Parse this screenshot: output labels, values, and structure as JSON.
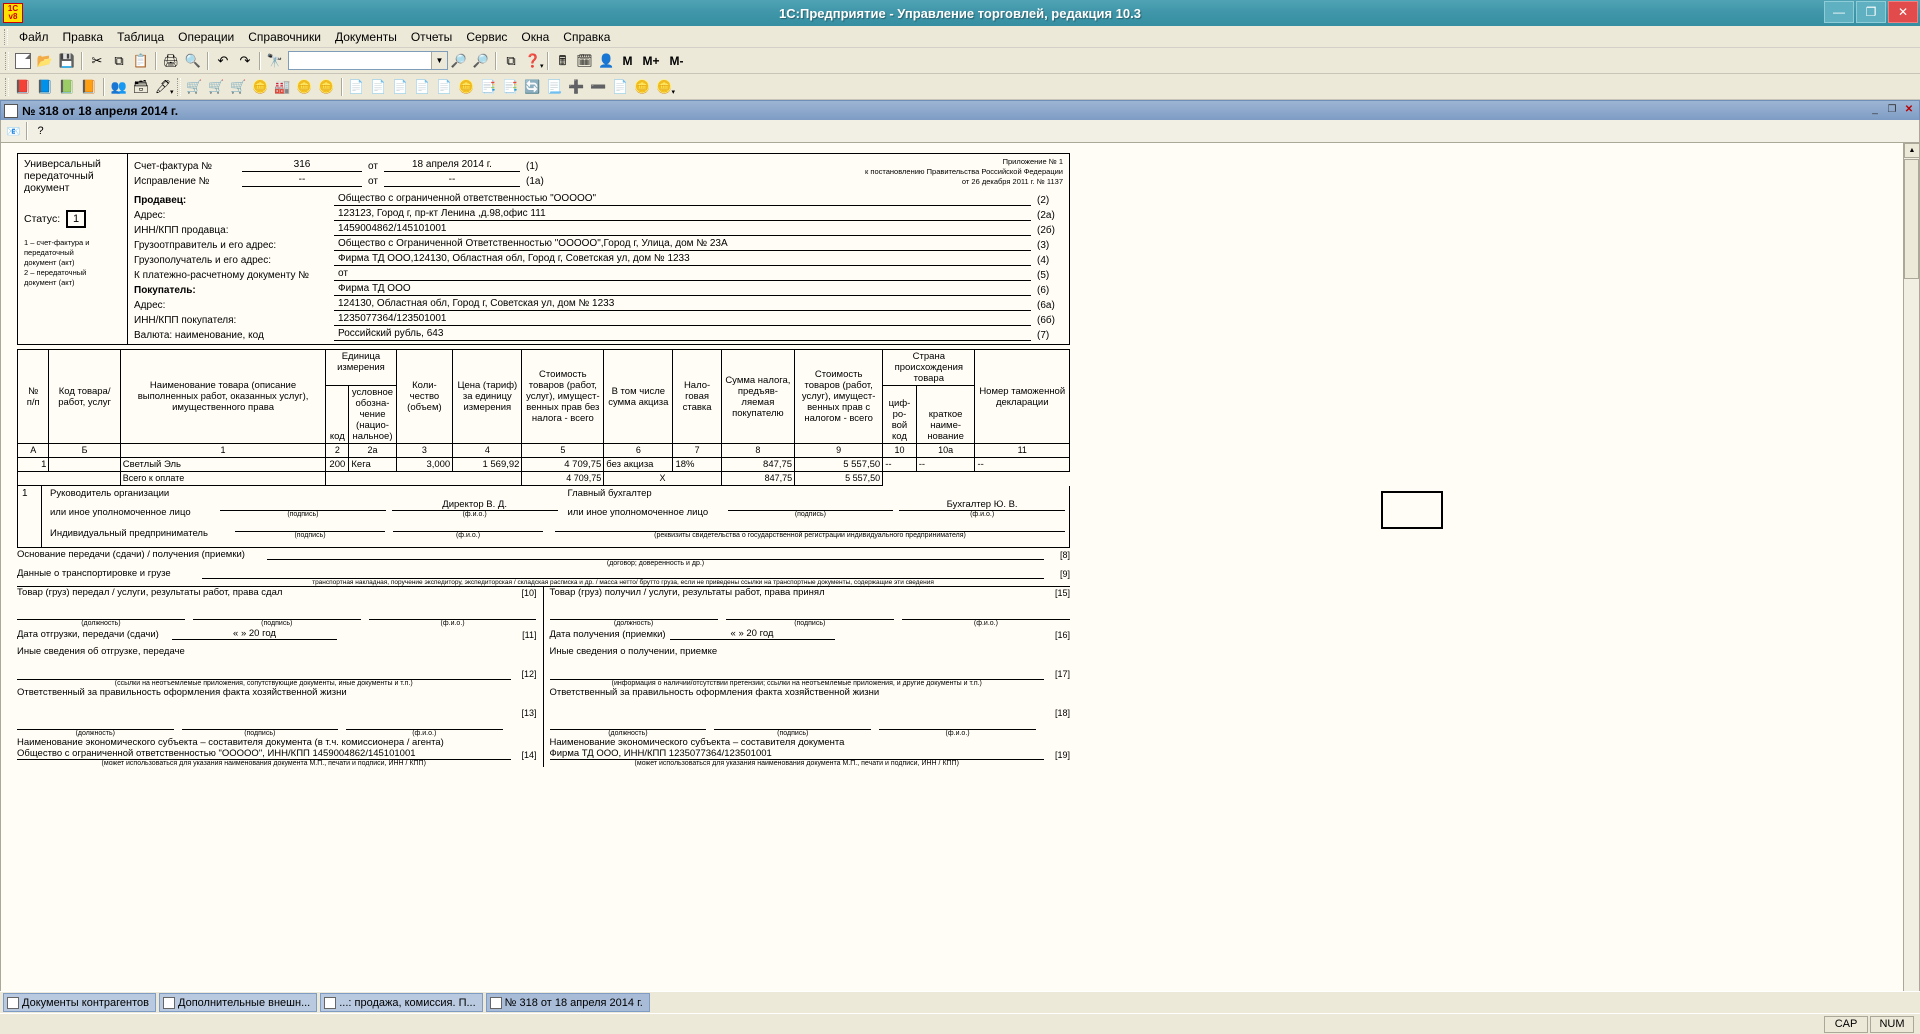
{
  "window": {
    "title": "1С:Предприятие - Управление торговлей, редакция 10.3",
    "logo_top": "1С",
    "logo_bottom": "v8",
    "minimize": "—",
    "maximize": "❐",
    "close": "✕"
  },
  "menu": [
    "Файл",
    "Правка",
    "Таблица",
    "Операции",
    "Справочники",
    "Документы",
    "Отчеты",
    "Сервис",
    "Окна",
    "Справка"
  ],
  "toolbar1": {
    "combo_value": "",
    "memory": [
      "М",
      "М+",
      "М-"
    ]
  },
  "child_window": {
    "title": "№ 318 от 18 апреля 2014 г.",
    "minimize": "_",
    "restore": "❐",
    "close": "✕",
    "help_button": "?"
  },
  "form": {
    "doc_type_lines": [
      "Универсальный",
      "передаточный",
      "документ"
    ],
    "status_label": "Статус:",
    "status_value": "1",
    "status_notes": [
      "1 – счет-фактура и",
      "передаточный",
      "документ (акт)",
      "2 – передаточный",
      "документ (акт)"
    ],
    "approval": [
      "Приложение № 1",
      "к постановлению Правительства Российской Федерации",
      "от 26 декабря 2011 г. № 1137"
    ],
    "rows": [
      {
        "label": "Счет-фактура №",
        "value": "316",
        "ot": "от",
        "value2": "18 апреля 2014 г.",
        "code": "(1)"
      },
      {
        "label": "Исправление №",
        "value": "--",
        "ot": "от",
        "value2": "--",
        "code": "(1a)"
      }
    ],
    "fields": [
      {
        "label": "Продавец:",
        "value": "Общество с ограниченной ответственностью \"ООООО\"",
        "code": "(2)",
        "bold": true
      },
      {
        "label": "Адрес:",
        "value": "123123, Город г, пр-кт Ленина ,д.98,офис 111",
        "code": "(2а)",
        "bold": false
      },
      {
        "label": "ИНН/КПП продавца:",
        "value": "1459004862/145101001",
        "code": "(2б)",
        "bold": false
      },
      {
        "label": "Грузоотправитель и его адрес:",
        "value": "Общество с Ограниченной Ответственностью \"ООООО\",Город г, Улица, дом № 23А",
        "code": "(3)",
        "bold": false
      },
      {
        "label": "Грузополучатель и его адрес:",
        "value": "Фирма ТД ООО,124130, Областная обл, Город г, Советская ул, дом № 1233",
        "code": "(4)",
        "bold": false
      },
      {
        "label": "К платежно-расчетному документу №",
        "value": "от",
        "code": "(5)",
        "bold": false
      },
      {
        "label": "Покупатель:",
        "value": "Фирма ТД ООО",
        "code": "(6)",
        "bold": true
      },
      {
        "label": "Адрес:",
        "value": "124130, Областная обл, Город г, Советская ул, дом № 1233",
        "code": "(6а)",
        "bold": false
      },
      {
        "label": "ИНН/КПП покупателя:",
        "value": "1235077364/123501001",
        "code": "(6б)",
        "bold": false
      },
      {
        "label": "Валюта: наименование, код",
        "value": "Российский рубль, 643",
        "code": "(7)",
        "bold": false
      }
    ]
  },
  "goods_table": {
    "headers": {
      "num": "№\nп/п",
      "code": "Код товара/\nработ, услуг",
      "name": "Наименование товара (описание выполненных работ, оказанных услуг), имущественного права",
      "unit_group": "Единица измерения",
      "unit_code": "код",
      "unit_name": "условное обозна-\nчение (нацио-\nнальное)",
      "qty": "Коли-\nчество (объем)",
      "price": "Цена (тариф) за единицу измерения",
      "cost_no_tax": "Стоимость товаров (работ, услуг), имущест-\nвенных прав без налога - всего",
      "excise": "В том числе сумма акциза",
      "tax_rate": "Нало-\nговая ставка",
      "tax_sum": "Сумма налога, предъяв-\nляемая покупателю",
      "cost_with_tax": "Стоимость товаров (работ, услуг), имущест-\nвенных прав с налогом - всего",
      "country_group": "Страна происхождения товара",
      "country_code": "циф-\nро-\nвой код",
      "country_name": "краткое наиме-\nнование",
      "customs": "Номер таможенной декларации"
    },
    "column_numbers": [
      "А",
      "Б",
      "1",
      "2",
      "2а",
      "3",
      "4",
      "5",
      "6",
      "7",
      "8",
      "9",
      "10",
      "10а",
      "11"
    ],
    "rows": [
      {
        "num": "1",
        "code": "",
        "name": "Светлый Эль",
        "unit_code": "200",
        "unit_name": "Кега",
        "qty": "3,000",
        "price": "1 569,92",
        "cost_no_tax": "4 709,75",
        "excise": "без акциза",
        "tax_rate": "18%",
        "tax_sum": "847,75",
        "cost_with_tax": "5 557,50",
        "country_code": "--",
        "country_name": "--",
        "customs": "--"
      }
    ],
    "total": {
      "label": "Всего к оплате",
      "cost_no_tax": "4 709,75",
      "excise": "X",
      "tax_sum": "847,75",
      "cost_with_tax": "5 557,50"
    }
  },
  "signatures": {
    "block_number": "1",
    "head_title_l1": "Руководитель организации",
    "head_title_l2": "или иное уполномоченное лицо",
    "head_name": "Директор В. Д.",
    "accountant_title_l1": "Главный бухгалтер",
    "accountant_title_l2": "или иное уполномоченное лицо",
    "accountant_name": "Бухгалтер Ю. В.",
    "entrepreneur": "Индивидуальный предприниматель",
    "cap_signature": "(подпись)",
    "cap_fio": "(ф.и.о.)",
    "cap_certificate": "(реквизиты свидетельства о государственной  регистрации индивидуального предпринимателя)"
  },
  "lower": {
    "basis_label": "Основание передачи (сдачи) / получения (приемки)",
    "basis_tag": "[8]",
    "basis_cap": "(договор; доверенность и др.)",
    "transport_label": "Данные о транспортировке и грузе",
    "transport_tag": "[9]",
    "transport_cap": "транспортная накладная, поручение экспедитору, экспедиторская / складская расписка и др. / масса нетто/ брутто груза, если не приведены ссылки на транспортные документы, содержащие эти сведения",
    "left": {
      "handover_label": "Товар (груз) передал / услуги, результаты работ, права сдал",
      "handover_tag": "[10]",
      "cap_position": "(должность)",
      "cap_signature": "(подпись)",
      "cap_fio": "(ф.и.о.)",
      "date_label": "Дата отгрузки, передачи (сдачи)",
      "date_value": "«      »                    20        год",
      "date_tag": "[11]",
      "other_label": "Иные сведения об отгрузке, передаче",
      "other_tag": "[12]",
      "other_cap": "(ссылки на неотъемлемые приложения, сопутствующие документы, иные документы и т.п.)",
      "responsible_label": "Ответственный за правильность оформления факта хозяйственной жизни",
      "responsible_tag": "[13]",
      "entity_label": "Наименование экономического субъекта – составителя документа (в т.ч. комиссионера / агента)",
      "entity_value": "Общество с ограниченной ответственностью \"ООООО\", ИНН/КПП 1459004862/145101001",
      "entity_tag": "[14]",
      "entity_cap": "(может использоваться для указания наименования документа М.П., печати и подписи, ИНН / КПП)"
    },
    "right": {
      "handover_label": "Товар (груз) получил / услуги, результаты работ, права принял",
      "handover_tag": "[15]",
      "cap_position": "(должность)",
      "cap_signature": "(подпись)",
      "cap_fio": "(ф.и.о.)",
      "date_label": "Дата получения (приемки)",
      "date_value": "«      »                    20        год",
      "date_tag": "[16]",
      "other_label": "Иные сведения о получении, приемке",
      "other_tag": "[17]",
      "other_cap": "(информация о наличии/отсутствии претензии; ссылки на неотъемлемые приложения, и другие  документы и т.п.)",
      "responsible_label": "Ответственный за правильность оформления факта хозяйственной жизни",
      "responsible_tag": "[18]",
      "entity_label": "Наименование экономического субъекта – составителя документа",
      "entity_value": "Фирма ТД ООО, ИНН/КПП 1235077364/123501001",
      "entity_tag": "[19]",
      "entity_cap": "(может использоваться для указания наименования документа М.П., печати и подписи, ИНН / КПП)"
    }
  },
  "taskbar": [
    {
      "label": "Документы контрагентов",
      "active": false
    },
    {
      "label": "Дополнительные внешн...",
      "active": false
    },
    {
      "label": "...: продажа, комиссия. П...",
      "active": false
    },
    {
      "label": "№ 318 от 18 апреля 2014 г.",
      "active": true
    }
  ],
  "statusbar": {
    "cap": "CAP",
    "num": "NUM"
  }
}
